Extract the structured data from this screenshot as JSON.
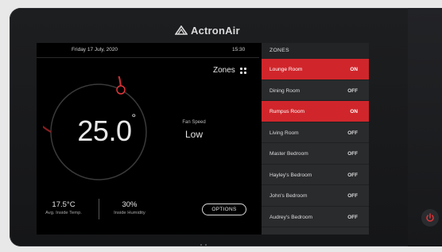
{
  "brand": {
    "name": "ActronAir"
  },
  "status_bar": {
    "date": "Friday 17 July, 2020",
    "time": "15:30"
  },
  "zones_button": {
    "label": "Zones"
  },
  "thermostat": {
    "temperature": "25.0",
    "degree_symbol": "°",
    "fan_speed_label": "Fan Speed",
    "fan_speed_value": "Low"
  },
  "stats": {
    "inside_temp_value": "17.5°C",
    "inside_temp_label": "Avg. Inside Temp.",
    "humidity_value": "30%",
    "humidity_label": "Inside Humidity"
  },
  "options_button": {
    "label": "OPTIONS"
  },
  "zones": {
    "header": "ZONES",
    "items": [
      {
        "name": "Lounge Room",
        "state": "ON"
      },
      {
        "name": "Dining Room",
        "state": "OFF"
      },
      {
        "name": "Rumpus Room",
        "state": "ON"
      },
      {
        "name": "Living Room",
        "state": "OFF"
      },
      {
        "name": "Master Bedroom",
        "state": "OFF"
      },
      {
        "name": "Hayley's Bedroom",
        "state": "OFF"
      },
      {
        "name": "John's Bedroom",
        "state": "OFF"
      },
      {
        "name": "Audrey's Bedroom",
        "state": "OFF"
      }
    ]
  },
  "colors": {
    "accent": "#d0262b",
    "screen_bg": "#000000",
    "panel_bg": "#2a2b2d"
  },
  "icons": {
    "zones": "grid-dots-icon",
    "power": "power-icon",
    "logo": "actronair-logo-icon"
  }
}
